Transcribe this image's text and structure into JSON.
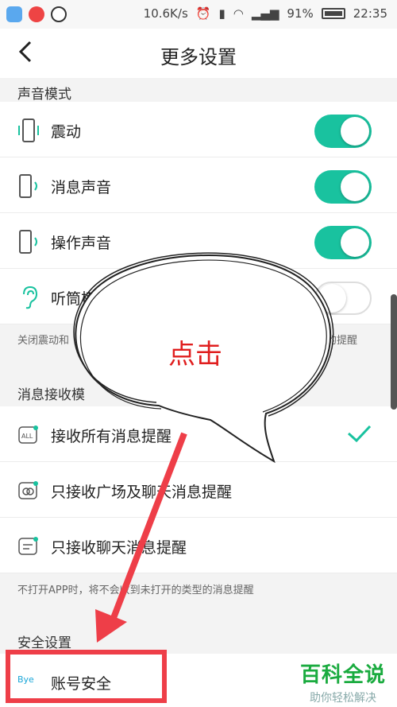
{
  "status_bar": {
    "network_speed": "10.6K/s",
    "battery_percent": "91%",
    "time": "22:35"
  },
  "header": {
    "title": "更多设置"
  },
  "sound_section": {
    "title": "声音模式",
    "items": [
      {
        "label": "震动",
        "enabled": true
      },
      {
        "label": "消息声音",
        "enabled": true
      },
      {
        "label": "操作声音",
        "enabled": true
      },
      {
        "label": "听筒模",
        "enabled": false
      }
    ],
    "hint_left": "关闭震动和",
    "hint_right": "的提醒"
  },
  "message_section": {
    "title": "消息接收模",
    "items": [
      {
        "label": "接收所有消息提醒",
        "selected": true
      },
      {
        "label": "只接收广场及聊天消息提醒",
        "selected": false
      },
      {
        "label": "只接收聊天消息提醒",
        "selected": false
      }
    ],
    "hint": "不打开APP时，将不会收到未打开的类型的消息提醒"
  },
  "security_section": {
    "title": "安全设置",
    "items": [
      {
        "label": "账号安全",
        "icon_text": "Bye"
      }
    ]
  },
  "annotation": {
    "text": "点击"
  },
  "watermark": {
    "name": "百科全说",
    "tagline": "助你轻松解决"
  },
  "colors": {
    "accent": "#19c29f",
    "annotation_red": "#ee3e48"
  }
}
